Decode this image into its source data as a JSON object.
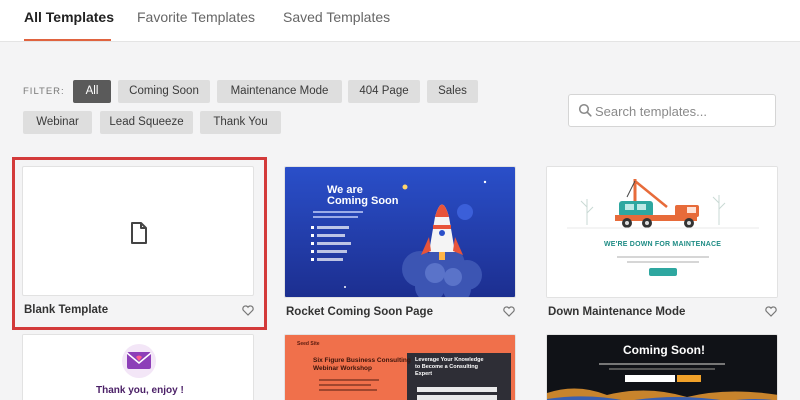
{
  "tabs": [
    {
      "label": "All Templates",
      "active": true
    },
    {
      "label": "Favorite Templates",
      "active": false
    },
    {
      "label": "Saved Templates",
      "active": false
    }
  ],
  "filter": {
    "label": "FILTER:",
    "chips": [
      {
        "label": "All",
        "active": true
      },
      {
        "label": "Coming Soon"
      },
      {
        "label": "Maintenance Mode"
      },
      {
        "label": "404 Page"
      },
      {
        "label": "Sales"
      },
      {
        "label": "Webinar"
      },
      {
        "label": "Lead Squeeze"
      },
      {
        "label": "Thank You"
      }
    ]
  },
  "search": {
    "placeholder": "Search templates..."
  },
  "templates": [
    {
      "name": "Blank Template",
      "selected": true,
      "icon": "file-icon"
    },
    {
      "name": "Rocket Coming Soon Page",
      "heading_line1": "We are",
      "heading_line2": "Coming Soon"
    },
    {
      "name": "Down Maintenance Mode",
      "headline": "WE'RE DOWN FOR MAINTENACE"
    },
    {
      "thumb_text": "Thank you, enjoy !"
    },
    {
      "brand": "Seed Site",
      "headline_line1": "Six Figure Business Consulting",
      "headline_line2": "Webinar Workshop",
      "panel_line1": "Leverage Your Knowledge",
      "panel_line2": "to Become a Consulting",
      "panel_line3": "Expert"
    },
    {
      "thumb_text": "Coming Soon!"
    }
  ],
  "colors": {
    "accent": "#e0633f",
    "selected_border": "#d33a3a",
    "chip_active": "#5a5a5a",
    "chip": "#dedede"
  }
}
